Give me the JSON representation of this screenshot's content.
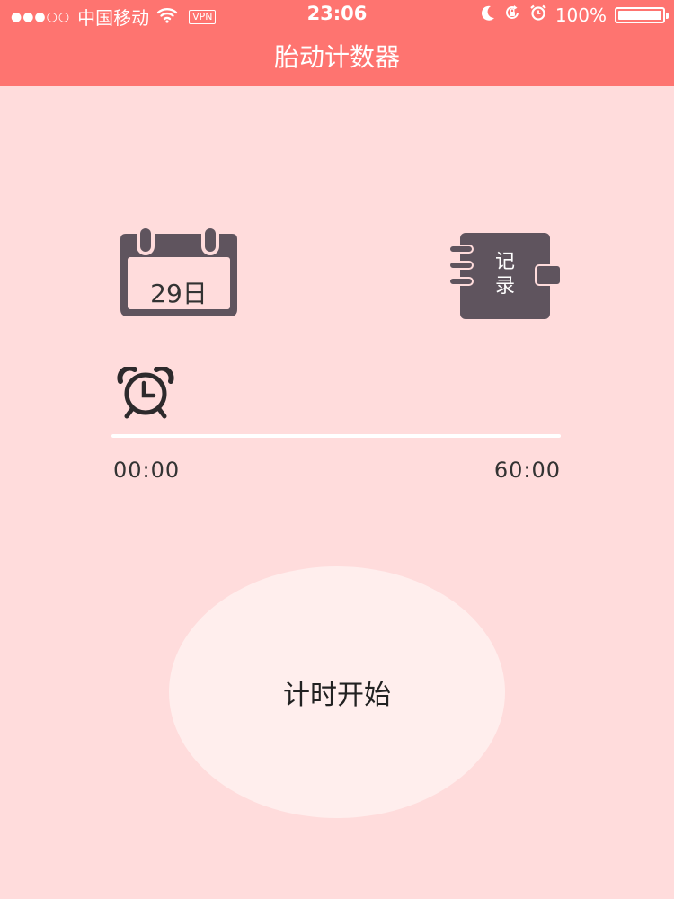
{
  "status_bar": {
    "signal": "●●●○○",
    "carrier": "中国移动",
    "vpn": "VPN",
    "time": "23:06",
    "battery": "100%",
    "icons": [
      "wifi-icon",
      "moon-icon",
      "rotation-lock-icon",
      "alarm-icon",
      "battery-icon"
    ]
  },
  "nav": {
    "title": "胎动计数器"
  },
  "calendar": {
    "day_label": "29日",
    "icon": "calendar-icon"
  },
  "record": {
    "label_line1": "记",
    "label_line2": "录",
    "icon": "notebook-icon"
  },
  "timer": {
    "icon": "alarm-clock-icon",
    "start_time": "00:00",
    "end_time": "60:00",
    "progress": 0
  },
  "start_button": {
    "label": "计时开始"
  },
  "colors": {
    "accent": "#fe7470",
    "background": "#ffdcdc",
    "icon": "#5f545e",
    "button": "#ffeeed"
  }
}
